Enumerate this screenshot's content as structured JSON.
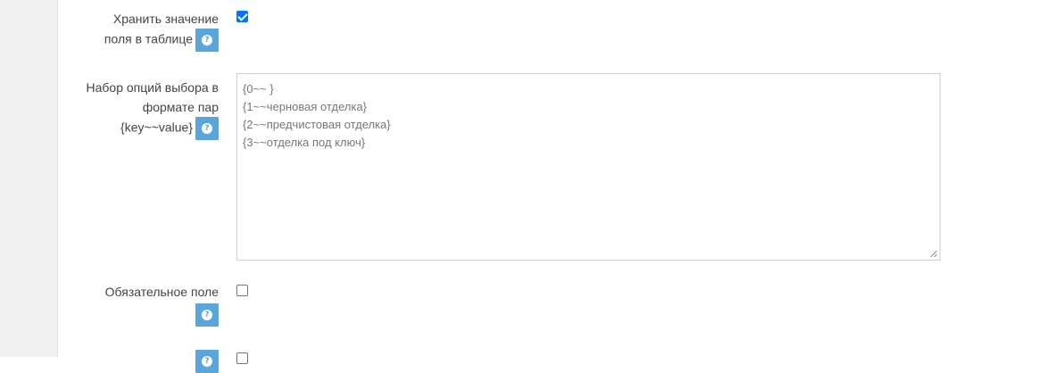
{
  "fields": {
    "store_in_table": {
      "label_line1": "Хранить значение",
      "label_line2": "поля в таблице",
      "checked": true,
      "help_icon": "question-circle-icon"
    },
    "options_set": {
      "label_line1": "Набор опций выбора в",
      "label_line2": "формате пар",
      "label_line3": "{key~~value}",
      "help_icon": "question-circle-icon",
      "lines": [
        "{0~~ }",
        "{1~~черновая отделка}",
        "{2~~предчистовая отделка}",
        "{3~~отделка под ключ}"
      ]
    },
    "required": {
      "label_line1": "Обязательное поле",
      "checked": false,
      "help_icon": "question-circle-icon"
    },
    "next_field": {
      "checked": false,
      "help_icon": "question-circle-icon"
    }
  },
  "colors": {
    "help_button": "#5aa5d9",
    "checkbox_checked": "#0075ff",
    "sidebar_bg": "#f1f1f1"
  }
}
